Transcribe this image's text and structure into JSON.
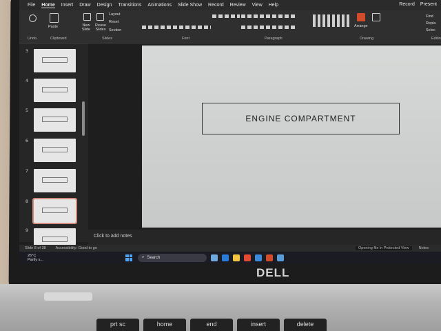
{
  "ribbon_tabs": [
    "File",
    "Home",
    "Insert",
    "Draw",
    "Design",
    "Transitions",
    "Animations",
    "Slide Show",
    "Record",
    "Review",
    "View",
    "Help"
  ],
  "active_tab": "Home",
  "ribbon_right": [
    "Record",
    "Present"
  ],
  "ribbon_groups": {
    "undo": "Undo",
    "clipboard": "Clipboard",
    "slides": "Slides",
    "font": "Font",
    "paragraph": "Paragraph",
    "drawing": "Drawing",
    "editing": "Editin"
  },
  "ribbon_buttons": {
    "paste": "Paste",
    "new_slide": "New Slide",
    "reuse_slides": "Reuse Slides",
    "layout": "Layout",
    "reset": "Reset",
    "section": "Section",
    "arrange": "Arrange",
    "find": "Find",
    "replace": "Repla",
    "select": "Selec"
  },
  "thumbnails": [
    {
      "num": "3",
      "selected": false
    },
    {
      "num": "4",
      "selected": false
    },
    {
      "num": "5",
      "selected": false
    },
    {
      "num": "6",
      "selected": false
    },
    {
      "num": "7",
      "selected": false
    },
    {
      "num": "8",
      "selected": true
    },
    {
      "num": "9",
      "selected": false
    }
  ],
  "slide": {
    "title": "ENGINE COMPARTMENT"
  },
  "notes_placeholder": "Click to add notes",
  "status": {
    "slide_count": "Slide 8 of 38",
    "accessibility": "Accessibility: Good to go",
    "protected_view": "Opening file in Protected View",
    "notes": "Notes"
  },
  "taskbar": {
    "temperature": "26°C",
    "weather": "Partly s...",
    "search": "Search"
  },
  "laptop": {
    "brand": "DELL",
    "keys": [
      "prt sc",
      "home",
      "end",
      "insert",
      "delete"
    ]
  },
  "colors": {
    "accent_selected": "#d28b7e",
    "windows_blue": "#4ea3f2"
  }
}
